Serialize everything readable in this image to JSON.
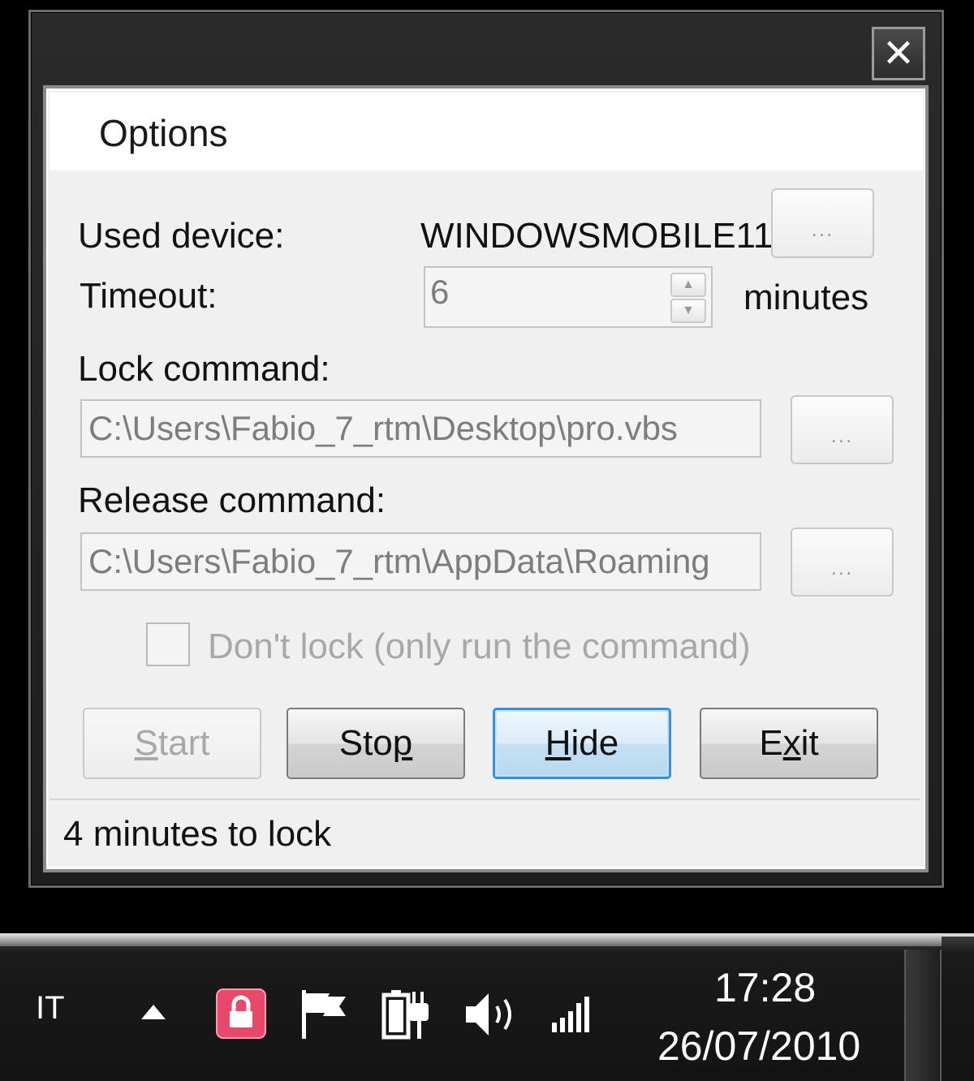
{
  "window": {
    "close_glyph": "✕"
  },
  "header": {
    "title": "Options"
  },
  "form": {
    "used_device_label": "Used device:",
    "used_device_value": "WINDOWSMOBILE11",
    "device_browse_label": "...",
    "timeout_label": "Timeout:",
    "timeout_value": "6",
    "timeout_unit": "minutes",
    "lock_command_label": "Lock command:",
    "lock_command_value": "C:\\Users\\Fabio_7_rtm\\Desktop\\pro.vbs",
    "lock_browse_label": "...",
    "release_command_label": "Release command:",
    "release_command_value": "C:\\Users\\Fabio_7_rtm\\AppData\\Roaming",
    "release_browse_label": "...",
    "dont_lock_label": "Don't lock (only run the command)",
    "dont_lock_checked": false
  },
  "buttons": {
    "start_prefix": "S",
    "start_rest": "tart",
    "stop_prefix": "Sto",
    "stop_underlined": "p",
    "hide_underlined": "H",
    "hide_rest": "ide",
    "exit_prefix": "E",
    "exit_underlined": "x",
    "exit_rest": "it"
  },
  "status": {
    "text": "4 minutes to lock"
  },
  "taskbar": {
    "language": "IT",
    "time": "17:28",
    "date": "26/07/2010",
    "icons": [
      "show-hidden-icons-arrow",
      "lock-icon",
      "action-center-flag-icon",
      "power-battery-icon",
      "volume-icon",
      "signal-bars-icon"
    ],
    "accent_lock_color": "#e8486a"
  }
}
